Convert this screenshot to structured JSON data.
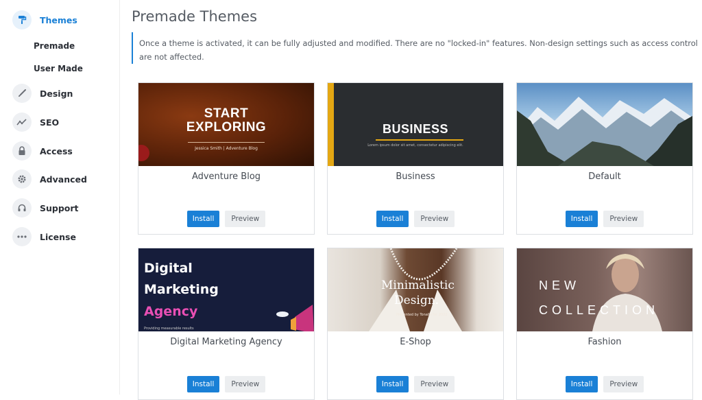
{
  "sidebar": {
    "items": [
      {
        "label": "Themes",
        "icon": "paint-roller-icon",
        "active": true
      },
      {
        "label": "Design",
        "icon": "brush-icon"
      },
      {
        "label": "SEO",
        "icon": "trend-icon"
      },
      {
        "label": "Access",
        "icon": "lock-icon"
      },
      {
        "label": "Advanced",
        "icon": "gear-icon"
      },
      {
        "label": "Support",
        "icon": "headset-icon"
      },
      {
        "label": "License",
        "icon": "dots-icon"
      }
    ],
    "subitems": [
      "Premade",
      "User Made"
    ]
  },
  "page": {
    "title": "Premade Themes",
    "notice": "Once a theme is activated, it can be fully adjusted and modified. There are no \"locked-in\" features. Non-design settings such as access control are not affected."
  },
  "buttons": {
    "install": "Install",
    "preview": "Preview"
  },
  "themes": [
    {
      "name": "Adventure Blog",
      "thumb_lines": [
        "START",
        "EXPLORING"
      ],
      "thumb_sub": "Jessica Smith | Adventure Blog"
    },
    {
      "name": "Business",
      "thumb_lines": [
        "BUSINESS"
      ],
      "thumb_sub": "Lorem ipsum dolor sit amet, consectetur adipiscing elit."
    },
    {
      "name": "Default"
    },
    {
      "name": "Digital Marketing Agency",
      "thumb_lines": [
        "Digital",
        "Marketing",
        "Agency"
      ],
      "thumb_sub": "Providing measurable results"
    },
    {
      "name": "E-Shop",
      "thumb_lines": [
        "Minimalistic",
        "Design."
      ],
      "thumb_sub": "Presented by Tonalla for 2022"
    },
    {
      "name": "Fashion",
      "thumb_lines": [
        "NEW",
        "COLLECTION"
      ]
    }
  ],
  "colors": {
    "accent": "#1a80d6",
    "active_bg": "#e6f1fb"
  }
}
